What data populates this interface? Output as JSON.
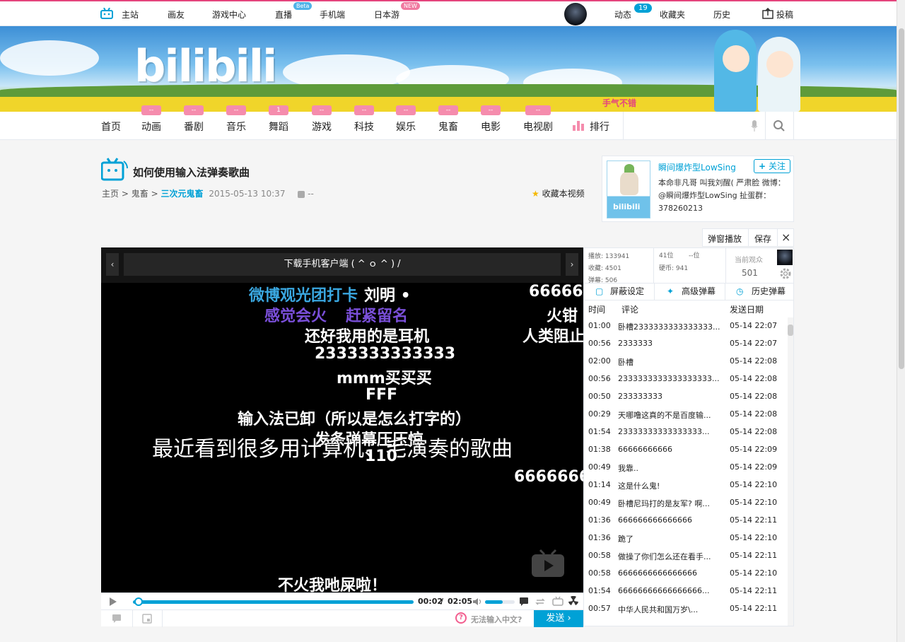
{
  "top": {
    "home": "主站",
    "huayou": "画友",
    "game": "游戏中心",
    "live": "直播",
    "live_badge": "Beta",
    "mobile": "手机端",
    "jp": "日本游",
    "jp_badge": "NEW",
    "dynamic": "动态",
    "dynamic_count": "19",
    "fav": "收藏夹",
    "history": "历史",
    "upload": "投稿"
  },
  "banner": {
    "logo": "bilibili",
    "tag": "手气不错"
  },
  "nav": {
    "items": [
      {
        "label": "首页",
        "count": ""
      },
      {
        "label": "动画",
        "count": "--"
      },
      {
        "label": "番剧",
        "count": "--"
      },
      {
        "label": "音乐",
        "count": "--"
      },
      {
        "label": "舞蹈",
        "count": "1"
      },
      {
        "label": "游戏",
        "count": "--"
      },
      {
        "label": "科技",
        "count": "--"
      },
      {
        "label": "娱乐",
        "count": "--"
      },
      {
        "label": "鬼畜",
        "count": "--"
      },
      {
        "label": "电影",
        "count": "--"
      },
      {
        "label": "电视剧",
        "count": "--"
      }
    ],
    "rank": "排行"
  },
  "video": {
    "title": "如何使用输入法弹奏歌曲",
    "crumb_home": "主页",
    "crumb_sep": ">",
    "crumb_cat": "鬼畜",
    "crumb_sub": "三次元鬼畜",
    "date": "2015-05-13 10:37",
    "views": "--",
    "fav": "收藏本视频"
  },
  "up": {
    "name": "瞬间爆炸型LowSing",
    "follow": "关注",
    "desc": "本命非凡哥 叫我刘醒( 严肃脸 微博：@瞬间爆炸型LowSing 扯蛋群：378260213"
  },
  "toolbar": {
    "popup": "弹窗播放",
    "save": "保存",
    "close": "×"
  },
  "player": {
    "banner": "下载手机客户端 ( ^ ｏ ^ ) /",
    "time_cur": "00:02",
    "time_sep": "/",
    "time_total": "02:05",
    "progress": 0.016,
    "volume": 0.6,
    "placeholder": "无法输入中文?",
    "send": "发送 ›"
  },
  "danmaku": [
    {
      "text": "微博观光团打卡",
      "color": "#3aa7e0"
    },
    {
      "text": "刘明 •",
      "color": "#fff"
    },
    {
      "text": "666666",
      "color": "#fff"
    },
    {
      "text": "感觉会火",
      "color": "#7a4fd9"
    },
    {
      "text": "赶紧留名",
      "color": "#7a4fd9"
    },
    {
      "text": "火钳",
      "color": "#fff"
    },
    {
      "text": "还好我用的是耳机",
      "color": "#fff"
    },
    {
      "text": "人类阻止",
      "color": "#fff"
    },
    {
      "text": "2333333333333",
      "color": "#fff"
    },
    {
      "text": "mmm买买买",
      "color": "#fff"
    },
    {
      "text": "FFF",
      "color": "#fff"
    },
    {
      "text": "输入法已卸（所以是怎么打字的）",
      "color": "#fff"
    },
    {
      "text": "发条弹幕压压惊",
      "color": "#fff"
    },
    {
      "text": "最近看到很多用计算机、毛演奏的歌曲",
      "color": "#fff"
    },
    {
      "text": "110",
      "color": "#fff"
    },
    {
      "text": "6666666",
      "color": "#fff"
    },
    {
      "text": "不火我吔屎啦！",
      "color": "#fff"
    }
  ],
  "stats": {
    "play": "播放: 133941",
    "collect": "收藏: 4501",
    "danmu": "弹幕: 506",
    "rank1": "41位",
    "rank2": "--位",
    "coin": "硬币: 941",
    "viewers_label": "当前观众",
    "viewers": "501"
  },
  "tabs": {
    "block": "屏蔽设定",
    "advanced": "高级弹幕",
    "history": "历史弹幕"
  },
  "list_head": {
    "time": "时间",
    "comment": "评论",
    "date": "发送日期"
  },
  "list": [
    {
      "t": "01:00",
      "c": "卧槽2333333333333333...",
      "d": "05-14 22:07"
    },
    {
      "t": "00:56",
      "c": "2333333",
      "d": "05-14 22:07"
    },
    {
      "t": "02:00",
      "c": "卧槽",
      "d": "05-14 22:08"
    },
    {
      "t": "00:56",
      "c": "2333333333333333333...",
      "d": "05-14 22:08"
    },
    {
      "t": "00:50",
      "c": "233333333",
      "d": "05-14 22:08"
    },
    {
      "t": "00:29",
      "c": "天哪噜这真的不是百度输...",
      "d": "05-14 22:08"
    },
    {
      "t": "01:54",
      "c": "23333333333333333...",
      "d": "05-14 22:08"
    },
    {
      "t": "01:38",
      "c": "66666666666",
      "d": "05-14 22:09"
    },
    {
      "t": "00:49",
      "c": "我靠..",
      "d": "05-14 22:09"
    },
    {
      "t": "01:14",
      "c": "这是什么鬼!",
      "d": "05-14 22:10"
    },
    {
      "t": "00:49",
      "c": "卧槽尼玛打的是友军? 啊...",
      "d": "05-14 22:10"
    },
    {
      "t": "01:36",
      "c": "666666666666666",
      "d": "05-14 22:11"
    },
    {
      "t": "01:36",
      "c": "跪了",
      "d": "05-14 22:10"
    },
    {
      "t": "00:58",
      "c": "做操了你们怎么还在看手...",
      "d": "05-14 22:11"
    },
    {
      "t": "00:58",
      "c": "6666666666666666",
      "d": "05-14 22:10"
    },
    {
      "t": "01:54",
      "c": "66666666666666666...",
      "d": "05-14 22:11"
    },
    {
      "t": "00:57",
      "c": "中华人民共和国万岁\\...",
      "d": "05-14 22:11"
    }
  ]
}
